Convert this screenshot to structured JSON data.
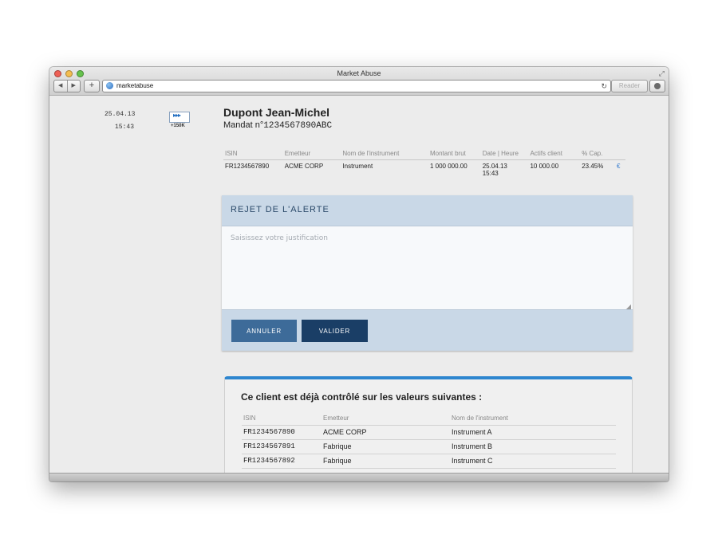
{
  "window": {
    "title": "Market Abuse",
    "url": "marketabuse",
    "reader_label": "Reader",
    "nav_back": "◀",
    "nav_forward": "▶",
    "add_tab": "+",
    "reload": "↻",
    "fullscreen": "⤢"
  },
  "sidebar": {
    "date": "25.04.13",
    "time": "15:43",
    "flow_label": "+150K"
  },
  "client": {
    "name": "Dupont Jean-Michel",
    "mandat_prefix": "Mandat n°",
    "mandat_number": "1234567890ABC"
  },
  "instrument_table": {
    "headers": [
      "ISIN",
      "Emetteur",
      "Nom de l'instrument",
      "Montant brut",
      "Date | Heure",
      "Actifs client",
      "% Cap."
    ],
    "row": {
      "isin": "FR1234567890",
      "emetteur": "ACME CORP",
      "nom": "Instrument",
      "montant": "1 000 000.00",
      "date": "25.04.13",
      "heure": "15:43",
      "actifs": "10 000.00",
      "cap": "23.45%",
      "currency": "€"
    }
  },
  "reject_panel": {
    "title": "REJET DE L'ALERTE",
    "placeholder": "Saisissez votre justification",
    "cancel_label": "ANNULER",
    "validate_label": "VALIDER"
  },
  "controlled": {
    "title": "Ce client est déjà contrôlé sur les valeurs suivantes :",
    "headers": [
      "ISIN",
      "Emetteur",
      "Nom de l'instrument"
    ],
    "rows": [
      {
        "isin": "FR1234567890",
        "emetteur": "ACME CORP",
        "nom": "Instrument A"
      },
      {
        "isin": "FR1234567891",
        "emetteur": "Fabrique",
        "nom": "Instrument B"
      },
      {
        "isin": "FR1234567892",
        "emetteur": "Fabrique",
        "nom": "Instrument C"
      }
    ]
  },
  "colors": {
    "accent_blue": "#2e86cf",
    "panel_bg": "#c9d8e7",
    "button_cancel": "#3d6b99",
    "button_validate": "#1a3e66"
  },
  "icons": {
    "flow": "triple-chevron-icon",
    "url": "globe-icon",
    "download": "download-icon"
  }
}
